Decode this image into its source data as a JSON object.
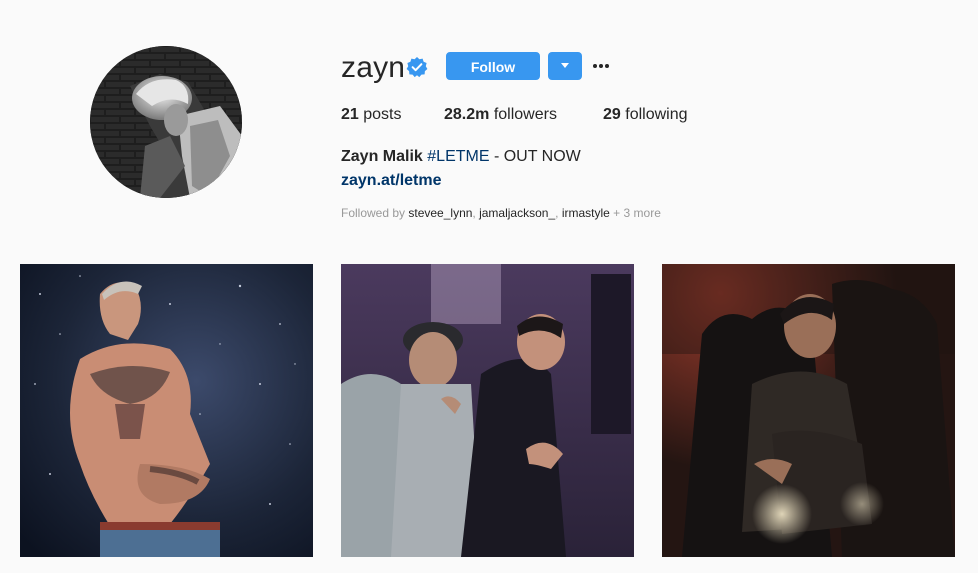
{
  "profile": {
    "username": "zayn",
    "verified": true,
    "follow_label": "Follow",
    "stats": {
      "posts_count": "21",
      "posts_label": "posts",
      "followers_count": "28.2m",
      "followers_label": "followers",
      "following_count": "29",
      "following_label": "following"
    },
    "bio": {
      "full_name": "Zayn Malik",
      "hashtag": "#LETME",
      "tagline": " - OUT NOW",
      "link": "zayn.at/letme"
    },
    "followed_by": {
      "prefix": "Followed by ",
      "users": [
        "stevee_lynn",
        "jamaljackson_",
        "irmastyle"
      ],
      "more": "+ 3 more"
    }
  },
  "colors": {
    "accent": "#3897f0",
    "link": "#003569",
    "background": "#fafafa",
    "muted": "#999999"
  },
  "icons": {
    "verified": "verified-badge-icon",
    "dropdown": "chevron-down-icon",
    "more": "more-options-icon"
  }
}
